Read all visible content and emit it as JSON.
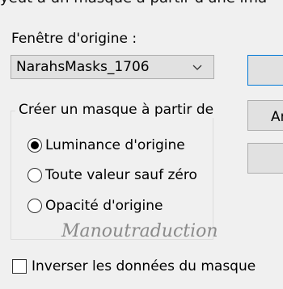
{
  "dialog": {
    "cut_title": "yeut à un masque à partir d'une ima"
  },
  "source": {
    "label": "Fenêtre d'origine :",
    "selected": "NarahsMasks_1706"
  },
  "group": {
    "legend": "Créer un masque à partir de",
    "options": [
      {
        "label": "Luminance d'origine",
        "checked": true
      },
      {
        "label": "Toute valeur sauf zéro",
        "checked": false
      },
      {
        "label": "Opacité d'origine",
        "checked": false
      }
    ]
  },
  "buttons": {
    "second_partial": "Ar"
  },
  "watermark": "Manoutraduction",
  "invert": {
    "label": "Inverser les données du masque",
    "checked": false
  }
}
